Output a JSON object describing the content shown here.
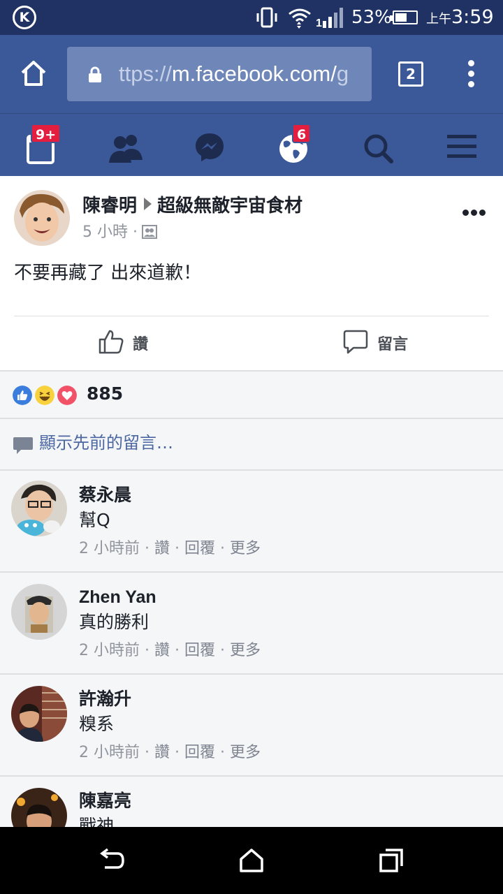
{
  "status_bar": {
    "battery_percent": "53%",
    "time_prefix": "上午",
    "time": "3:59"
  },
  "browser": {
    "url_prefix": "ttps://",
    "url_host": "m.facebook.com/",
    "url_tail": "g",
    "tab_count": "2"
  },
  "fb_nav": {
    "feed_badge": "9+",
    "notifications_badge": "6",
    "icons": [
      "news-feed-icon",
      "friends-icon",
      "messenger-icon",
      "globe-icon",
      "search-icon",
      "menu-icon"
    ]
  },
  "post": {
    "author": "陳睿明",
    "group": "超級無敵宇宙食材",
    "time": "5 小時 ·",
    "text": "不要再藏了 出來道歉！",
    "like_label": "讚",
    "comment_label": "留言"
  },
  "reactions": {
    "count": "885",
    "colors": {
      "like": "#3b7ddd",
      "haha": "#f7d23e",
      "love": "#f25268"
    }
  },
  "previous_comments_label": "顯示先前的留言…",
  "comments": [
    {
      "name": "蔡永晨",
      "text": "幫Q",
      "time": "2 小時前",
      "like": "讚",
      "reply": "回覆",
      "more": "更多"
    },
    {
      "name": "Zhen Yan",
      "text": "真的勝利",
      "time": "2 小時前",
      "like": "讚",
      "reply": "回覆",
      "more": "更多"
    },
    {
      "name": "許瀚升",
      "text": "糗系",
      "time": "2 小時前",
      "like": "讚",
      "reply": "回覆",
      "more": "更多"
    },
    {
      "name": "陳嘉亮",
      "text": "戰神"
    }
  ],
  "meta_separator": "·"
}
